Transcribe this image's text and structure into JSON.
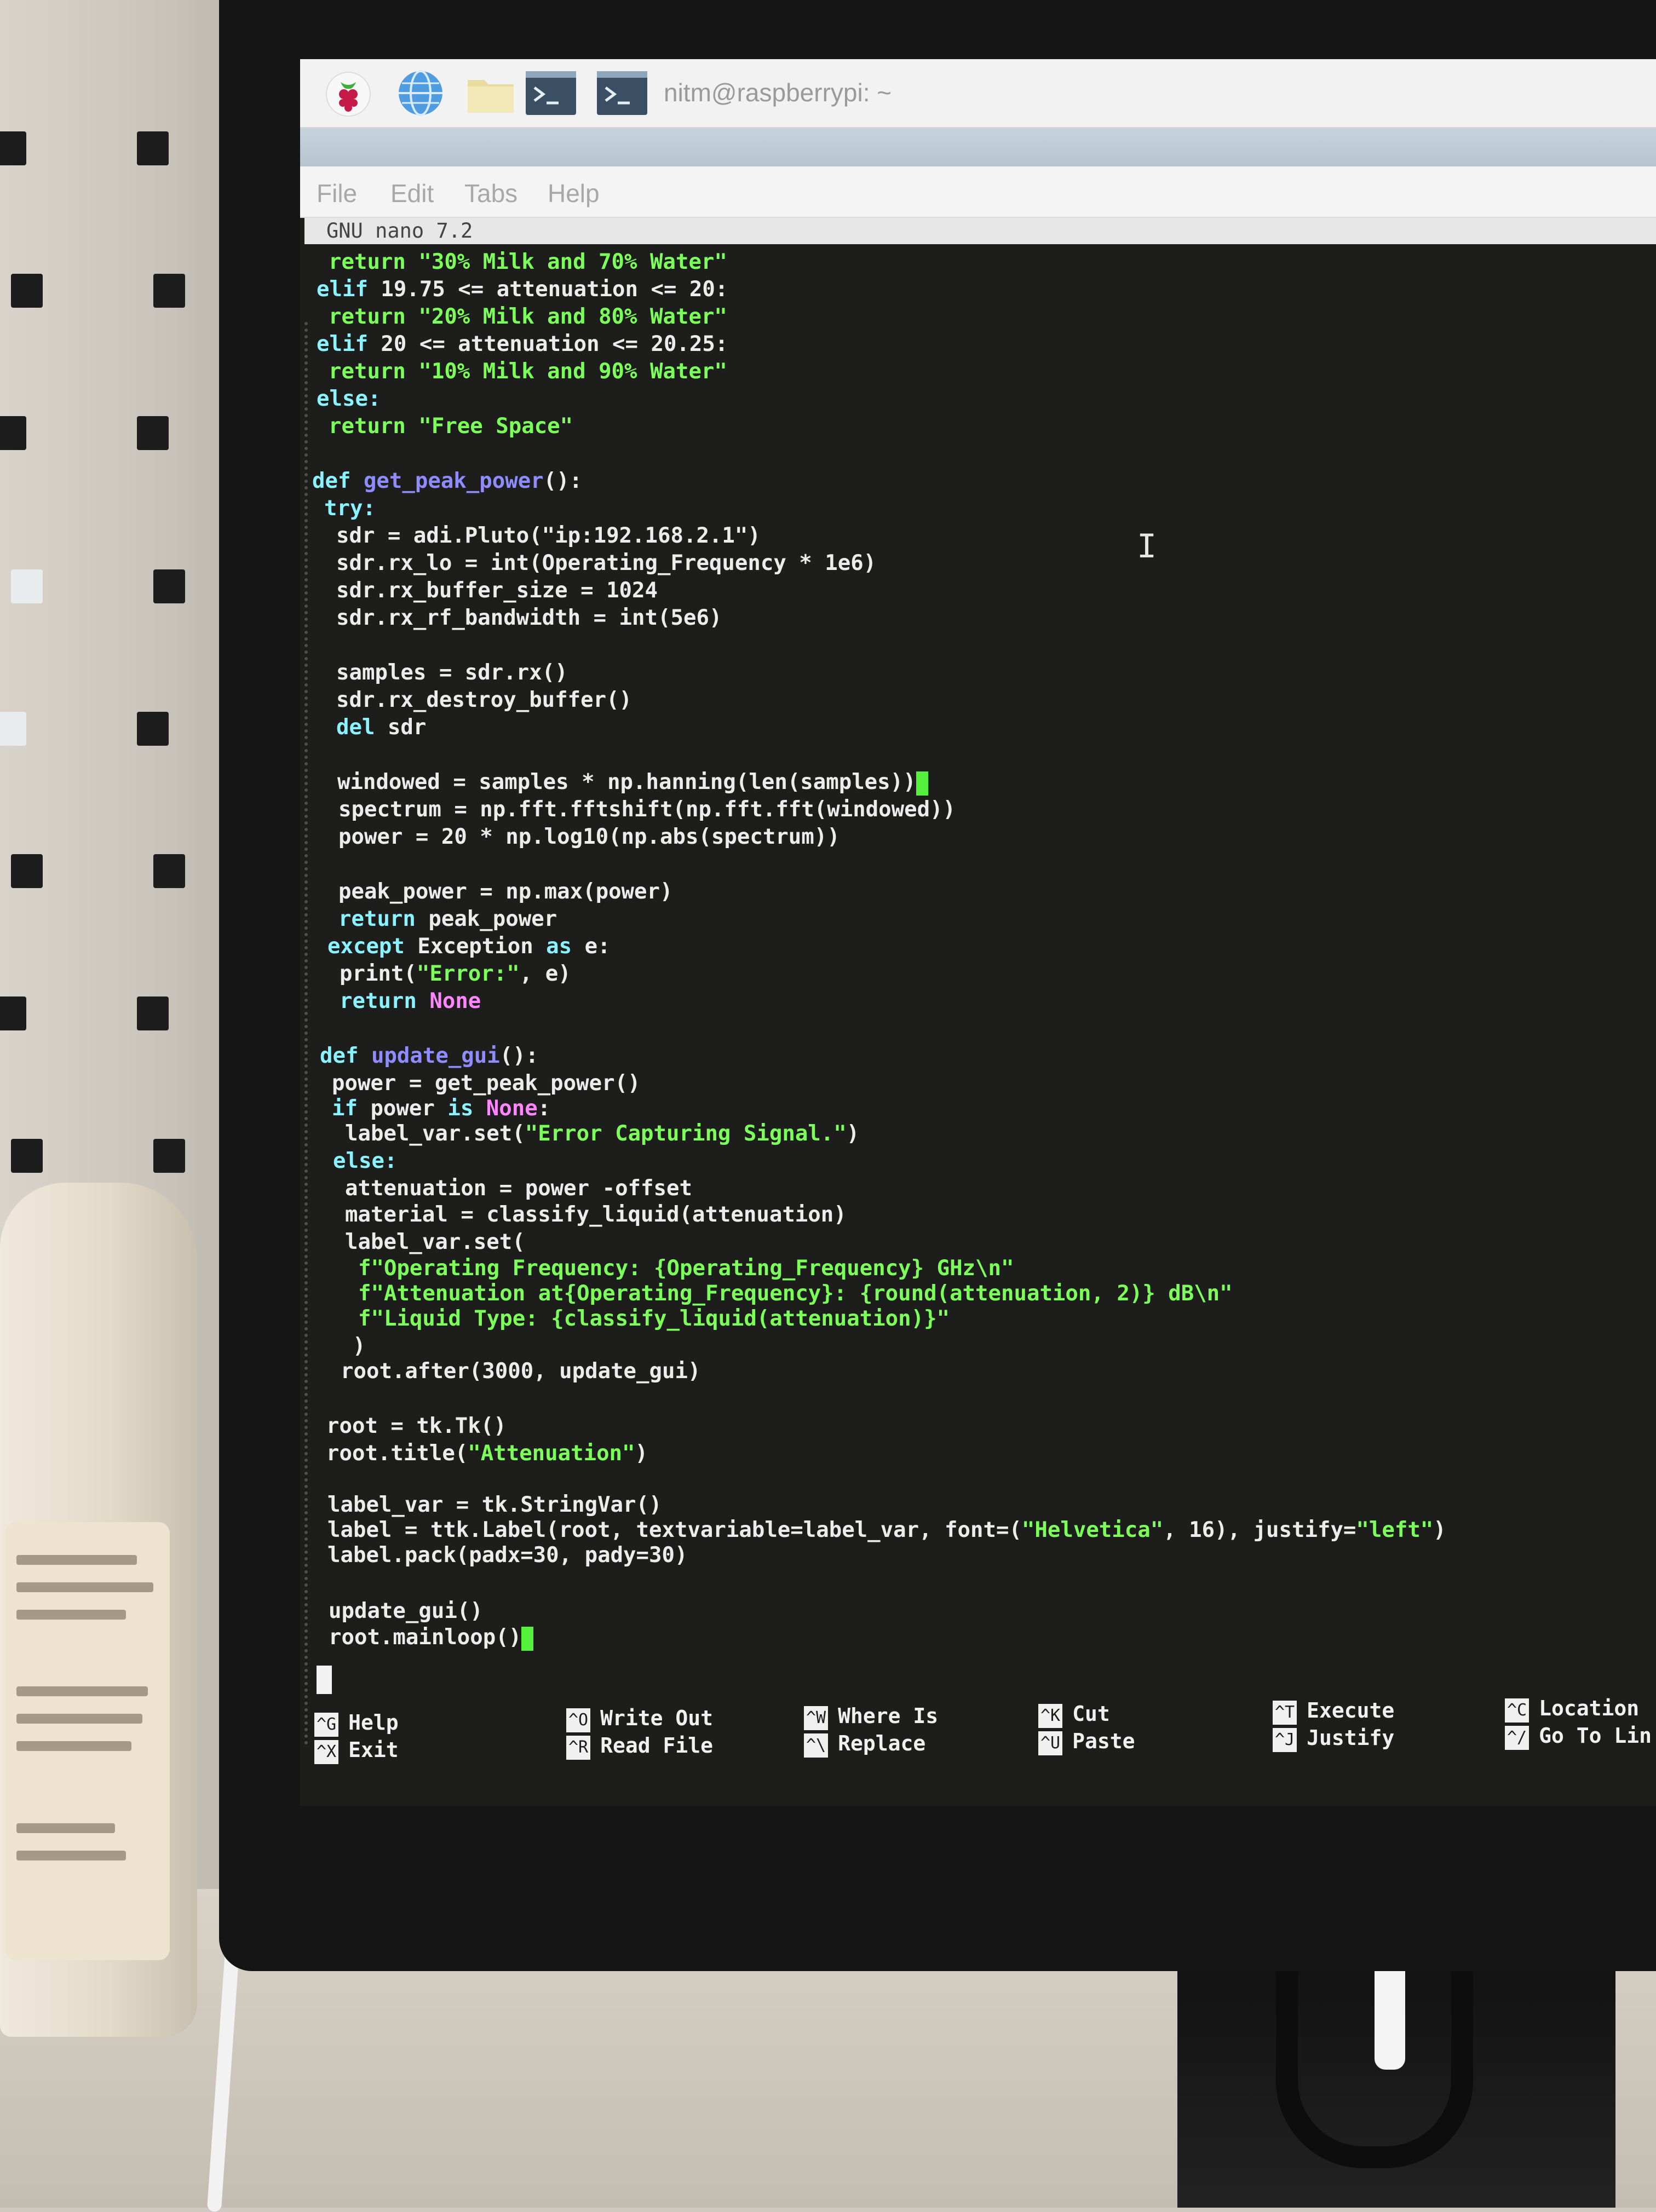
{
  "taskbar": {
    "icons": [
      "raspberry-icon",
      "globe-icon",
      "folder-icon",
      "terminal-icon"
    ],
    "task_title": "nitm@raspberrypi: ~"
  },
  "menu": {
    "items": [
      "File",
      "Edit",
      "Tabs",
      "Help"
    ]
  },
  "editor": {
    "header": "GNU nano 7.2",
    "lines": {
      "l01": "return \"30% Milk and 70% Water\"",
      "l02_kw": "elif",
      "l02": " 19.75 <= attenuation <= 20:",
      "l03": "return \"20% Milk and 80% Water\"",
      "l04_kw": "elif",
      "l04": " 20 <= attenuation <= 20.25:",
      "l05": "return \"10% Milk and 90% Water\"",
      "l06": "else:",
      "l07": "return \"Free Space\"",
      "l09_kw": "def",
      "l09_fn": "get_peak_power",
      "l09": "():",
      "l10": "try:",
      "l11": "sdr = adi.Pluto(\"ip:192.168.2.1\")",
      "l12": "sdr.rx_lo = int(Operating_Frequency * 1e6)",
      "l13": "sdr.rx_buffer_size = 1024",
      "l14": "sdr.rx_rf_bandwidth = int(5e6)",
      "l16": "samples = sdr.rx()",
      "l17": "sdr.rx_destroy_buffer()",
      "l18_kw": "del",
      "l18": " sdr",
      "l20": "windowed = samples * np.hanning(len(samples))",
      "l21": "spectrum = np.fft.fftshift(np.fft.fft(windowed))",
      "l22": "power = 20 * np.log10(np.abs(spectrum))",
      "l24": "peak_power = np.max(power)",
      "l25_kw": "return",
      "l25": " peak_power",
      "l26_kw": "except",
      "l26a": " Exception ",
      "l26_kw2": "as",
      "l26b": " e:",
      "l27a": "print(",
      "l27_str": "\"Error:\"",
      "l27b": ", e)",
      "l28_kw": "return",
      "l28_none": " None",
      "l30_kw": "def",
      "l30_fn": "update_gui",
      "l30": "():",
      "l31": "power = get_peak_power()",
      "l32_kw": "if",
      "l32a": " power ",
      "l32_kw2": "is",
      "l32_none": " None",
      "l32b": ":",
      "l33a": "label_var.set(",
      "l33_str": "\"Error Capturing Signal.\"",
      "l33b": ")",
      "l34": "else:",
      "l35": "attenuation = power -offset",
      "l36": "material = classify_liquid(attenuation)",
      "l37": "label_var.set(",
      "l38": "f\"Operating Frequency: {Operating_Frequency} GHz\\n\"",
      "l39": "f\"Attenuation at{Operating_Frequency}: {round(attenuation, 2)} dB\\n\"",
      "l40": "f\"Liquid Type: {classify_liquid(attenuation)}\"",
      "l41": ")",
      "l42": "root.after(3000, update_gui)",
      "l44": "root = tk.Tk()",
      "l45a": "root.title(",
      "l45_str": "\"Attenuation\"",
      "l45b": ")",
      "l47": "label_var = tk.StringVar()",
      "l48a": "label = ttk.Label(root, textvariable=label_var, font=(",
      "l48_str1": "\"Helvetica\"",
      "l48b": ", 16), justify=",
      "l48_str2": "\"left\"",
      "l48c": ")",
      "l49": "label.pack(padx=30, pady=30)",
      "l51": "update_gui()",
      "l52": "root.mainloop()"
    }
  },
  "shortcuts": [
    {
      "k1": "^G",
      "l1": "Help",
      "k2": "^X",
      "l2": "Exit"
    },
    {
      "k1": "^O",
      "l1": "Write Out",
      "k2": "^R",
      "l2": "Read File"
    },
    {
      "k1": "^W",
      "l1": "Where Is",
      "k2": "^\\",
      "l2": "Replace"
    },
    {
      "k1": "^K",
      "l1": "Cut",
      "k2": "^U",
      "l2": "Paste"
    },
    {
      "k1": "^T",
      "l1": "Execute",
      "k2": "^J",
      "l2": "Justify"
    },
    {
      "k1": "^C",
      "l1": "Location",
      "k2": "^/",
      "l2": "Go To Lin"
    }
  ]
}
